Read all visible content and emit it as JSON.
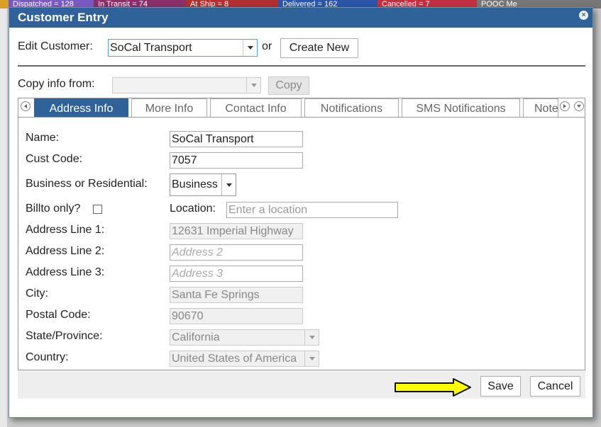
{
  "background": {
    "strip": [
      {
        "text": "Dispatched = 128",
        "color": "#7a5ac0"
      },
      {
        "text": "In Transit = 74",
        "color": "#8a2f6a"
      },
      {
        "text": "At Ship = 8",
        "color": "#b03030"
      },
      {
        "text": "Delivered = 162",
        "color": "#2a55a8"
      },
      {
        "text": "Cancelled = 7",
        "color": "#c03040"
      },
      {
        "text": "POOC Me",
        "color": "#777"
      }
    ]
  },
  "dialog": {
    "title": "Customer Entry",
    "close_glyph": "×"
  },
  "edit_customer": {
    "label": "Edit Customer:",
    "value": "SoCal Transport",
    "or_text": "or",
    "create_new_label": "Create New"
  },
  "copy_info": {
    "label": "Copy info from:",
    "value": "",
    "copy_label": "Copy"
  },
  "tabs": [
    {
      "label": "Address Info",
      "active": true
    },
    {
      "label": "More Info",
      "active": false
    },
    {
      "label": "Contact Info",
      "active": false
    },
    {
      "label": "Notifications",
      "active": false
    },
    {
      "label": "SMS Notifications",
      "active": false
    },
    {
      "label": "Notes",
      "active": false
    }
  ],
  "form": {
    "name": {
      "label": "Name:",
      "value": "SoCal Transport"
    },
    "cust_code": {
      "label": "Cust Code:",
      "value": "7057"
    },
    "business": {
      "label": "Business or Residential:",
      "value": "Business"
    },
    "billto": {
      "label": "Billto only?"
    },
    "location": {
      "label": "Location:",
      "placeholder": "Enter a location"
    },
    "address1": {
      "label": "Address Line 1:",
      "value": "12631 Imperial Highway"
    },
    "address2": {
      "label": "Address Line 2:",
      "placeholder": "Address 2"
    },
    "address3": {
      "label": "Address Line 3:",
      "placeholder": "Address 3"
    },
    "city": {
      "label": "City:",
      "value": "Santa Fe Springs"
    },
    "postal": {
      "label": "Postal Code:",
      "value": "90670"
    },
    "state": {
      "label": "State/Province:",
      "value": "California"
    },
    "country": {
      "label": "Country:",
      "value": "United States of America"
    }
  },
  "footer": {
    "save_label": "Save",
    "cancel_label": "Cancel",
    "pointer_color": "#ffff00"
  }
}
